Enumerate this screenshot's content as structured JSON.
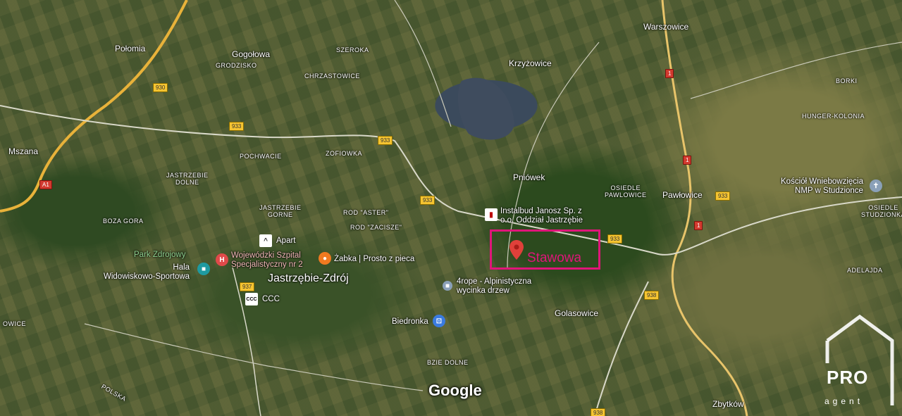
{
  "map": {
    "places": [
      {
        "key": "polomia",
        "text": "Połomia"
      },
      {
        "key": "gogolowa",
        "text": "Gogołowa"
      },
      {
        "key": "grodzisko",
        "text": "GRODZISKO"
      },
      {
        "key": "szeroka",
        "text": "SZEROKA"
      },
      {
        "key": "chrzastowice",
        "text": "CHRZASTOWICE"
      },
      {
        "key": "krzyzowice",
        "text": "Krzyżowice"
      },
      {
        "key": "warszowice",
        "text": "Warszowice"
      },
      {
        "key": "borki",
        "text": "BORKI"
      },
      {
        "key": "hunger",
        "text": "HUNGER-KOLONIA"
      },
      {
        "key": "mszana",
        "text": "Mszana"
      },
      {
        "key": "pochwacie",
        "text": "POCHWACIE"
      },
      {
        "key": "zofiowka",
        "text": "ZOFIOWKA"
      },
      {
        "key": "jastrzebie_dolne",
        "text": "JASTRZEBIE\nDOLNE"
      },
      {
        "key": "pniowek",
        "text": "Pniówek"
      },
      {
        "key": "osiedle_pawlowice",
        "text": "OSIEDLE\nPAWLOWICE"
      },
      {
        "key": "pawlowice",
        "text": "Pawłowice"
      },
      {
        "key": "osiedle_studzionka",
        "text": "OSIEDLE\nSTUDZIONKA"
      },
      {
        "key": "jastrzebie_gorne",
        "text": "JASTRZEBIE\nGORNE"
      },
      {
        "key": "rod_aster",
        "text": "ROD \"ASTER\""
      },
      {
        "key": "rod_zacisze",
        "text": "ROD \"ZACISZE\""
      },
      {
        "key": "boza_gora",
        "text": "BOZA GORA"
      },
      {
        "key": "jastrzebie_zdroj",
        "text": "Jastrzębie-Zdrój"
      },
      {
        "key": "adelajda",
        "text": "ADELAJDA"
      },
      {
        "key": "golasowice",
        "text": "Golasowice"
      },
      {
        "key": "bzie_dolne",
        "text": "BZIE DOLNE"
      },
      {
        "key": "zbytkow",
        "text": "Zbytków"
      },
      {
        "key": "owice",
        "text": "OWICE"
      },
      {
        "key": "polska",
        "text": "POLSKA"
      }
    ],
    "pois": {
      "instalbud": "Instalbud Janosz Sp. z\no.o. Oddział Jastrzębie",
      "apart": "Apart",
      "szpital": "Wojewódzki Szpital\nSpecjalistyczny nr 2",
      "zabka": "Żabka | Prosto z pieca",
      "hala": "Hala\nWidowiskowo-Sportowa",
      "park": "Park Zdrojowy",
      "ccc": "CCC",
      "alpin": "4rope - Alpinistyczna\nwycinka drzew",
      "biedronka": "Biedronka",
      "kosciol": "Kościół Wniebowzięcia\nNMP w Studzionce"
    },
    "roads": [
      "930",
      "933",
      "933",
      "933",
      "933",
      "933",
      "937",
      "938",
      "938",
      "A1",
      "1",
      "1",
      "1"
    ],
    "marker_label": "Stawowa",
    "google": "Google",
    "logo_pro": "PRO",
    "logo_agent": "agent",
    "colors": {
      "highlight": "#e0157a",
      "shield": "#f5c431",
      "motorway": "#d23a2f"
    }
  }
}
